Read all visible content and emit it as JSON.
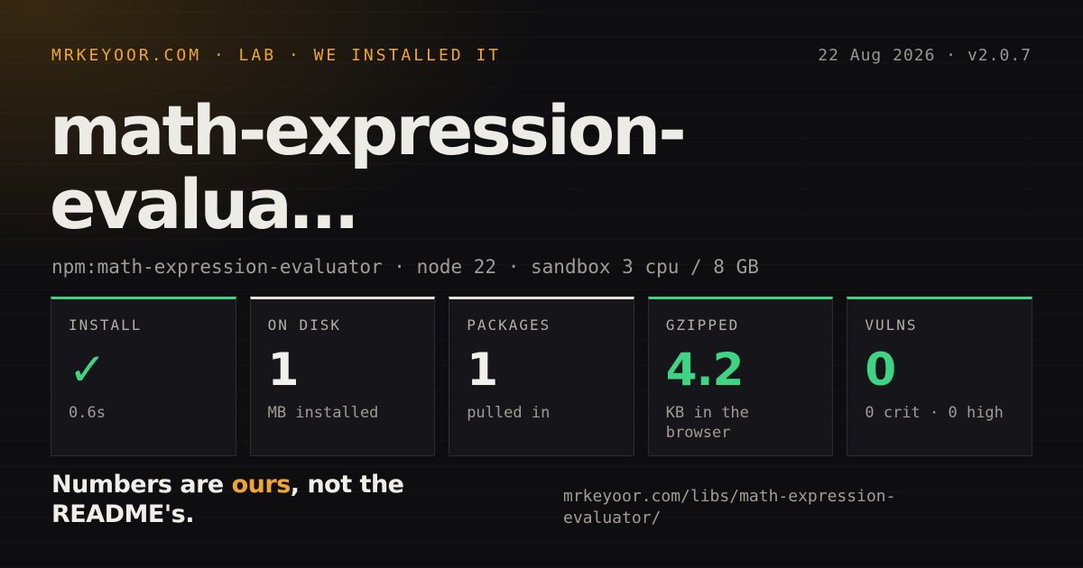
{
  "header": {
    "brand": "MRKEYOOR.COM · LAB · WE INSTALLED IT",
    "meta": "22 Aug 2026 · v2.0.7"
  },
  "title": "math-expression-evalua…",
  "subtitle": "npm:math-expression-evaluator · node 22 · sandbox 3 cpu / 8 GB",
  "cards": [
    {
      "label": "INSTALL",
      "value": "✓",
      "caption": "0.6s",
      "accent": "#3dd583",
      "value_color": "#3dd583"
    },
    {
      "label": "ON DISK",
      "value": "1",
      "caption": "MB installed",
      "accent": "#e3e1dc",
      "value_color": "#f2f0ea"
    },
    {
      "label": "PACKAGES",
      "value": "1",
      "caption": "pulled in",
      "accent": "#e3e1dc",
      "value_color": "#f2f0ea"
    },
    {
      "label": "GZIPPED",
      "value": "4.2",
      "caption": "KB in the browser",
      "accent": "#3dd583",
      "value_color": "#3dd583"
    },
    {
      "label": "VULNS",
      "value": "0",
      "caption": "0 crit · 0 high",
      "accent": "#3dd583",
      "value_color": "#3dd583"
    }
  ],
  "footer": {
    "tagline_before": "Numbers are ",
    "tagline_accent": "ours",
    "tagline_after": ", not the README's.",
    "url": "mrkeyoor.com/libs/math-expression-evaluator/"
  },
  "colors": {
    "brand_accent": "#f0a62e",
    "success": "#3dd583",
    "background": "#0e0e10"
  }
}
